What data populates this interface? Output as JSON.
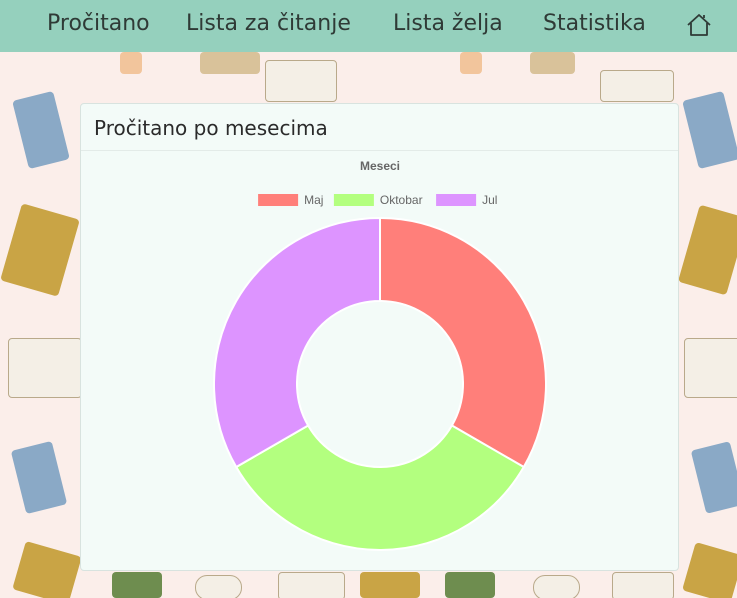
{
  "nav": {
    "items": [
      "Pročitano",
      "Lista za čitanje",
      "Lista želja",
      "Statistika"
    ],
    "home_icon": "home-icon",
    "bg_color": "#95d0bd"
  },
  "card": {
    "title": "Pročitano po mesecima"
  },
  "chart_data": {
    "type": "doughnut",
    "title": "Meseci",
    "legend_position": "top",
    "categories": [
      "Maj",
      "Oktobar",
      "Jul"
    ],
    "values": [
      1,
      1,
      1
    ],
    "colors": [
      "#ff7f7a",
      "#b3ff7f",
      "#dd94ff"
    ]
  }
}
